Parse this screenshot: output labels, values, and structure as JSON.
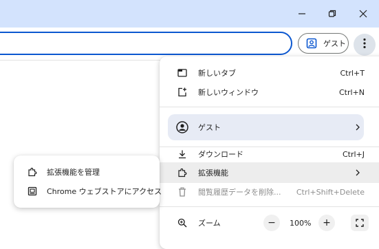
{
  "window": {
    "minimize_icon": "minimize-icon",
    "restore_icon": "restore-icon",
    "close_icon": "close-icon",
    "titlebar_color": "#d3e3fd"
  },
  "toolbar": {
    "profile_label": "ゲスト",
    "profile_icon": "profile-card-icon",
    "menu_icon": "three-dot-menu-icon",
    "accent_color": "#0b57d0"
  },
  "menu": {
    "new_tab": {
      "label": "新しいタブ",
      "shortcut": "Ctrl+T",
      "icon": "new-tab-icon"
    },
    "new_window": {
      "label": "新しいウィンドウ",
      "shortcut": "Ctrl+N",
      "icon": "new-window-icon"
    },
    "guest": {
      "label": "ゲスト",
      "icon": "account-circle-icon"
    },
    "downloads": {
      "label": "ダウンロード",
      "shortcut": "Ctrl+J",
      "icon": "download-icon"
    },
    "extensions": {
      "label": "拡張機能",
      "icon": "extension-puzzle-icon"
    },
    "clear_data": {
      "label": "閲覧履歴データを削除...",
      "shortcut": "Ctrl+Shift+Delete",
      "icon": "trash-icon"
    },
    "zoom": {
      "label": "ズーム",
      "value": "100%",
      "minus": "−",
      "plus": "+",
      "icon": "zoom-icon"
    }
  },
  "submenu": {
    "manage_extensions": {
      "label": "拡張機能を管理",
      "icon": "extension-puzzle-icon"
    },
    "web_store": {
      "label": "Chrome ウェブストアにアクセス",
      "icon": "web-store-icon"
    }
  }
}
